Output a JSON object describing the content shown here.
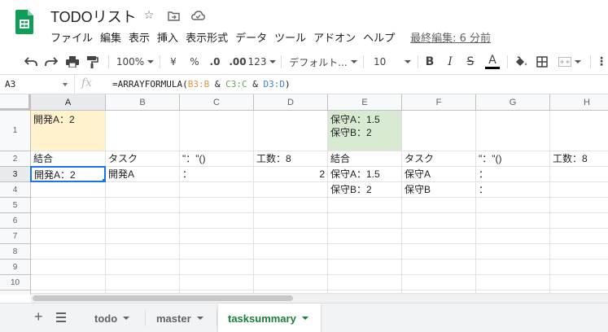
{
  "app": {
    "doc_title": "TODOリスト",
    "last_edit": "最終編集: 6 分前",
    "brand_color": "#0f9d58"
  },
  "menu": [
    "ファイル",
    "編集",
    "表示",
    "挿入",
    "表示形式",
    "データ",
    "ツール",
    "アドオン",
    "ヘルプ"
  ],
  "toolbar": {
    "zoom": "100%",
    "currency": "¥",
    "percent": "%",
    "dec_decrease": ".0",
    "dec_increase": ".00",
    "more_formats": "123",
    "font": "デフォルト...",
    "font_size": "10",
    "bold": "B",
    "italic": "I",
    "strike": "S",
    "text_color": "A",
    "more": "⋮"
  },
  "formula_bar": {
    "cell_ref": "A3",
    "fx": "fx",
    "formula_prefix": "=ARRAYFORMULA(",
    "ref_b": "B3:B",
    "amp1": " & ",
    "ref_c": "C3:C",
    "amp2": " & ",
    "ref_d": "D3:D",
    "formula_suffix": ")"
  },
  "columns": [
    "A",
    "B",
    "C",
    "D",
    "E",
    "F",
    "G",
    "H"
  ],
  "rows": [
    "1",
    "2",
    "3",
    "4",
    "5",
    "6",
    "7",
    "8",
    "9",
    "10"
  ],
  "cells": {
    "A1": "開発A：2",
    "E1": "保守A：1.5\n保守B：2",
    "A2": "結合",
    "B2": "タスク",
    "C2": "\"：\"()",
    "D2": "工数：8",
    "E2": "結合",
    "F2": "タスク",
    "G2": "\"：\"()",
    "H2": "工数：8",
    "A3": "開発A：2",
    "B3": "開発A",
    "C3": "：",
    "D3": "2",
    "E3": "保守A：1.5",
    "F3": "保守A",
    "G3": "：",
    "E4": "保守B：2",
    "F4": "保守B",
    "G4": "："
  },
  "sheets": {
    "add": "+",
    "tabs": [
      {
        "label": "todo"
      },
      {
        "label": "master"
      },
      {
        "label": "tasksummary"
      }
    ],
    "active_color": "#188038"
  }
}
